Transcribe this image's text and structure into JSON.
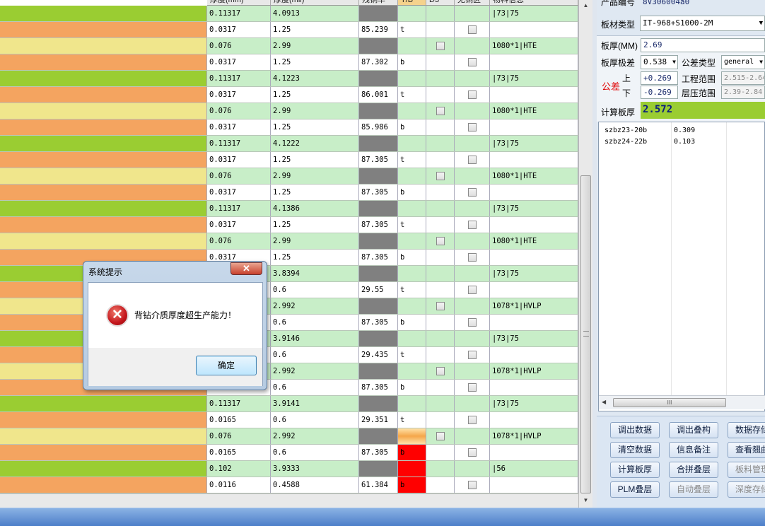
{
  "columns": [
    "厚度(mm)",
    "厚度(mil)",
    "残铜率",
    "T/B",
    "D3",
    "无铜区",
    "物料信息"
  ],
  "colors": {
    "green": "#9acd32",
    "orange": "#f4a460",
    "yellow": "#f0e68c",
    "dark": "#808080",
    "row_alt": "#c8eec8",
    "red": "#ff0000"
  },
  "rows": [
    {
      "color": "green",
      "mm": "0.11317",
      "mil": "4.0913",
      "cu": "",
      "tb": "",
      "d3": false,
      "nocu": false,
      "info": "|73|75"
    },
    {
      "color": "orange",
      "mm": "0.0317",
      "mil": "1.25",
      "cu": "85.239",
      "tb": "t",
      "d3": false,
      "nocu": true,
      "info": ""
    },
    {
      "color": "yellow",
      "mm": "0.076",
      "mil": "2.99",
      "cu": "",
      "tb": "",
      "d3": true,
      "nocu": false,
      "info": "1080*1|HTE"
    },
    {
      "color": "orange",
      "mm": "0.0317",
      "mil": "1.25",
      "cu": "87.302",
      "tb": "b",
      "d3": false,
      "nocu": true,
      "info": ""
    },
    {
      "color": "green",
      "mm": "0.11317",
      "mil": "4.1223",
      "cu": "",
      "tb": "",
      "d3": false,
      "nocu": false,
      "info": "|73|75"
    },
    {
      "color": "orange",
      "mm": "0.0317",
      "mil": "1.25",
      "cu": "86.001",
      "tb": "t",
      "d3": false,
      "nocu": true,
      "info": ""
    },
    {
      "color": "yellow",
      "mm": "0.076",
      "mil": "2.99",
      "cu": "",
      "tb": "",
      "d3": true,
      "nocu": false,
      "info": "1080*1|HTE"
    },
    {
      "color": "orange",
      "mm": "0.0317",
      "mil": "1.25",
      "cu": "85.986",
      "tb": "b",
      "d3": false,
      "nocu": true,
      "info": ""
    },
    {
      "color": "green",
      "mm": "0.11317",
      "mil": "4.1222",
      "cu": "",
      "tb": "",
      "d3": false,
      "nocu": false,
      "info": "|73|75"
    },
    {
      "color": "orange",
      "mm": "0.0317",
      "mil": "1.25",
      "cu": "87.305",
      "tb": "t",
      "d3": false,
      "nocu": true,
      "info": ""
    },
    {
      "color": "yellow",
      "mm": "0.076",
      "mil": "2.99",
      "cu": "",
      "tb": "",
      "d3": true,
      "nocu": false,
      "info": "1080*1|HTE"
    },
    {
      "color": "orange",
      "mm": "0.0317",
      "mil": "1.25",
      "cu": "87.305",
      "tb": "b",
      "d3": false,
      "nocu": true,
      "info": ""
    },
    {
      "color": "green",
      "mm": "0.11317",
      "mil": "4.1386",
      "cu": "",
      "tb": "",
      "d3": false,
      "nocu": false,
      "info": "|73|75"
    },
    {
      "color": "orange",
      "mm": "0.0317",
      "mil": "1.25",
      "cu": "87.305",
      "tb": "t",
      "d3": false,
      "nocu": true,
      "info": ""
    },
    {
      "color": "yellow",
      "mm": "0.076",
      "mil": "2.99",
      "cu": "",
      "tb": "",
      "d3": true,
      "nocu": false,
      "info": "1080*1|HTE"
    },
    {
      "color": "orange",
      "mm": "0.0317",
      "mil": "1.25",
      "cu": "87.305",
      "tb": "b",
      "d3": false,
      "nocu": true,
      "info": ""
    },
    {
      "color": "green",
      "mm": "",
      "mil": "3.8394",
      "cu": "",
      "tb": "",
      "d3": false,
      "nocu": false,
      "info": "|73|75"
    },
    {
      "color": "orange",
      "mm": "",
      "mil": "0.6",
      "cu": "29.55",
      "tb": "t",
      "d3": false,
      "nocu": true,
      "info": ""
    },
    {
      "color": "yellow",
      "mm": "",
      "mil": "2.992",
      "cu": "",
      "tb": "",
      "d3": true,
      "nocu": false,
      "info": "1078*1|HVLP"
    },
    {
      "color": "orange",
      "mm": "",
      "mil": "0.6",
      "cu": "87.305",
      "tb": "b",
      "d3": false,
      "nocu": true,
      "info": ""
    },
    {
      "color": "green",
      "mm": "",
      "mil": "3.9146",
      "cu": "",
      "tb": "",
      "d3": false,
      "nocu": false,
      "info": "|73|75"
    },
    {
      "color": "orange",
      "mm": "",
      "mil": "0.6",
      "cu": "29.435",
      "tb": "t",
      "d3": false,
      "nocu": true,
      "info": ""
    },
    {
      "color": "yellow",
      "mm": "",
      "mil": "2.992",
      "cu": "",
      "tb": "",
      "d3": true,
      "nocu": false,
      "info": "1078*1|HVLP"
    },
    {
      "color": "orange",
      "mm": "",
      "mil": "0.6",
      "cu": "87.305",
      "tb": "b",
      "d3": false,
      "nocu": true,
      "info": ""
    },
    {
      "color": "green",
      "mm": "0.11317",
      "mil": "3.9141",
      "cu": "",
      "tb": "",
      "d3": false,
      "nocu": false,
      "info": "|73|75"
    },
    {
      "color": "orange",
      "mm": "0.0165",
      "mil": "0.6",
      "cu": "29.351",
      "tb": "t",
      "d3": false,
      "nocu": true,
      "info": ""
    },
    {
      "color": "yellow",
      "mm": "0.076",
      "mil": "2.992",
      "cu": "",
      "tb": "",
      "tbHighlight": "orange",
      "d3": true,
      "nocu": false,
      "info": "1078*1|HVLP"
    },
    {
      "color": "orange",
      "mm": "0.0165",
      "mil": "0.6",
      "cu": "87.305",
      "tb": "b",
      "tbHighlight": "red",
      "d3": false,
      "nocu": true,
      "info": ""
    },
    {
      "color": "green",
      "mm": "0.102",
      "mil": "3.9333",
      "cu": "",
      "tb": "",
      "tbHighlight": "red",
      "d3": false,
      "nocu": false,
      "info": "|56"
    },
    {
      "color": "orange",
      "mm": "0.0116",
      "mil": "0.4588",
      "cu": "61.384",
      "tb": "b",
      "tbHighlight": "red",
      "d3": false,
      "nocu": true,
      "info": ""
    }
  ],
  "panel": {
    "product_no_label": "产品编号",
    "product_no_value": "8V306004a0",
    "board_type_label": "板材类型",
    "board_type_value": "IT-968+S1000-2M",
    "thickness_label": "板厚(MM)",
    "thickness_value": "2.69",
    "tolerance_label": "板厚极差",
    "tolerance_value": "0.538",
    "tol_type_label": "公差类型",
    "tol_type_value": "general",
    "tol_label": "公差",
    "upper_label": "上",
    "lower_label": "下",
    "upper_value": "+0.269",
    "lower_value": "-0.269",
    "eng_range_label": "工程范围",
    "eng_range_value": "2.515-2.64",
    "press_range_label": "层压范围",
    "press_range_value": "2.39-2.84",
    "calc_label": "计算板厚",
    "calc_value": "2.572",
    "list": [
      {
        "name": "szbz23-20b",
        "value": "0.309"
      },
      {
        "name": "szbz24-22b",
        "value": "0.103"
      }
    ],
    "hscroll_grip": "III",
    "buttons": [
      {
        "label": "调出数据",
        "enabled": true
      },
      {
        "label": "调出叠构",
        "enabled": true
      },
      {
        "label": "数据存储",
        "enabled": true
      },
      {
        "label": "清空数据",
        "enabled": true
      },
      {
        "label": "信息备注",
        "enabled": true
      },
      {
        "label": "查看翘曲",
        "enabled": true
      },
      {
        "label": "计算板厚",
        "enabled": true
      },
      {
        "label": "合拼叠层",
        "enabled": true
      },
      {
        "label": "板料管理",
        "enabled": false
      },
      {
        "label": "PLM叠层",
        "enabled": true
      },
      {
        "label": "自动叠层",
        "enabled": false
      },
      {
        "label": "深度存储",
        "enabled": false
      }
    ]
  },
  "dialog": {
    "title": "系统提示",
    "close": "✕",
    "icon": "error-icon",
    "icon_glyph": "✕",
    "message": "背钻介质厚度超生产能力！",
    "ok": "确定"
  }
}
